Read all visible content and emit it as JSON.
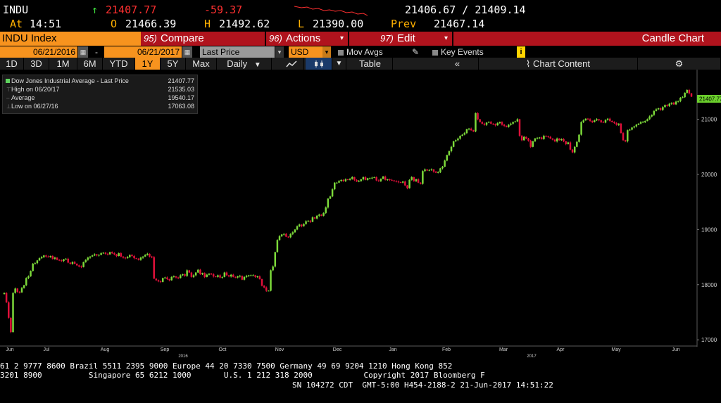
{
  "quote": {
    "ticker": "INDU",
    "up_arrow": "↑",
    "last": "21407.77",
    "change": "-59.37",
    "bid_ask": "21406.67 / 21409.14",
    "at_label": "At",
    "time": "14:51",
    "open_label": "O",
    "open": "21466.39",
    "high_label": "H",
    "high": "21492.62",
    "low_label": "L",
    "low": "21390.00",
    "prev_label": "Prev",
    "prev": "21467.14"
  },
  "titlebar": {
    "index": "INDU Index",
    "compare_num": "95)",
    "compare": "Compare",
    "actions_num": "96)",
    "actions": "Actions",
    "edit_num": "97)",
    "edit": "Edit",
    "dropdown_arrow": "▾",
    "chart_type": "Candle Chart"
  },
  "controls": {
    "start_date": "06/21/2016",
    "dash": "-",
    "end_date": "06/21/2017",
    "field": "Last Price",
    "currency": "USD",
    "mov_avgs": "Mov Avgs",
    "key_events": "Key Events",
    "info": "i",
    "calendar_icon": "calendar-icon",
    "pencil_icon": "pencil-icon"
  },
  "toolbar": {
    "periods": [
      "1D",
      "3D",
      "1M",
      "6M",
      "YTD",
      "1Y",
      "5Y",
      "Max"
    ],
    "active_period": "1Y",
    "frequency": "Daily",
    "freq_arrow": "▼",
    "table": "Table",
    "collapse": "«",
    "chart_content": "Chart Content",
    "settings": "⚙"
  },
  "legend": {
    "series": "Dow Jones Industrial Average - Last Price",
    "series_value": "21407.77",
    "high_label": "High on 06/20/17",
    "high_value": "21535.03",
    "avg_label": "Average",
    "avg_value": "19540.17",
    "low_label": "Low on 06/27/16",
    "low_value": "17063.08"
  },
  "chart_data": {
    "type": "candlestick",
    "title": "",
    "xlabel": "",
    "ylabel": "",
    "ylim": [
      16900,
      21900
    ],
    "yticks": [
      17000,
      18000,
      19000,
      20000,
      21000
    ],
    "last_price_label": "21407.77",
    "x_ticks": [
      "Jun",
      "Jul",
      "Aug",
      "Sep",
      "Oct",
      "Nov",
      "Dec",
      "Jan",
      "Feb",
      "Mar",
      "Apr",
      "May",
      "Jun"
    ],
    "year_labels": [
      "2016",
      "2017"
    ],
    "up_color": "#7cd93a",
    "down_color": "#e0103a",
    "grid": false,
    "closes": [
      17850,
      17680,
      17400,
      17140,
      17850,
      17930,
      17870,
      17860,
      17940,
      17990,
      18120,
      18150,
      18250,
      18380,
      18390,
      18440,
      18480,
      18500,
      18530,
      18510,
      18500,
      18520,
      18470,
      18490,
      18450,
      18440,
      18430,
      18460,
      18470,
      18400,
      18380,
      18410,
      18380,
      18350,
      18330,
      18320,
      18410,
      18450,
      18490,
      18510,
      18530,
      18550,
      18530,
      18540,
      18570,
      18580,
      18560,
      18550,
      18590,
      18570,
      18550,
      18520,
      18570,
      18510,
      18490,
      18480,
      18500,
      18540,
      18520,
      18480,
      18470,
      18450,
      18490,
      18510,
      18540,
      18560,
      18510,
      18500,
      18110,
      18080,
      18060,
      18050,
      18120,
      18130,
      18100,
      18080,
      18140,
      18150,
      18130,
      18120,
      18170,
      18190,
      18160,
      18260,
      18220,
      18140,
      18170,
      18220,
      18270,
      18190,
      18210,
      18140,
      18180,
      18200,
      18190,
      18150,
      18140,
      18170,
      18130,
      18140,
      18220,
      18170,
      18150,
      18180,
      18140,
      18130,
      18150,
      18160,
      18090,
      18140,
      18160,
      18170,
      18170,
      18170,
      18140,
      18150,
      18100,
      17980,
      17950,
      17890,
      17890,
      18260,
      18330,
      18590,
      18810,
      18880,
      18910,
      18920,
      18870,
      18860,
      18920,
      18950,
      19000,
      19060,
      19090,
      19060,
      19100,
      19150,
      19160,
      19140,
      19220,
      19200,
      19250,
      19270,
      19250,
      19300,
      19400,
      19560,
      19600,
      19730,
      19850,
      19850,
      19880,
      19900,
      19880,
      19910,
      19900,
      19920,
      19950,
      19900,
      19870,
      19880,
      19910,
      19950,
      19900,
      19930,
      19930,
      19940,
      19950,
      19890,
      19880,
      19920,
      19960,
      19900,
      19910,
      19900,
      19890,
      19880,
      19870,
      19860,
      19850,
      19870,
      19800,
      19750,
      19900,
      19950,
      19880,
      19910,
      19850,
      19830,
      20060,
      20090,
      20070,
      20080,
      20090,
      20050,
      20030,
      20040,
      20110,
      20140,
      20250,
      20350,
      20420,
      20500,
      20600,
      20620,
      20650,
      20700,
      20720,
      20750,
      20820,
      20830,
      20800,
      20780,
      21110,
      21000,
      20950,
      20920,
      20900,
      20940,
      20950,
      20920,
      20910,
      20890,
      20930,
      20950,
      20900,
      20880,
      20860,
      20900,
      20920,
      20950,
      20960,
      21000,
      20700,
      20620,
      20680,
      20650,
      20610,
      20500,
      20600,
      20650,
      20660,
      20670,
      20640,
      20700,
      20690,
      20680,
      20650,
      20630,
      20600,
      20650,
      20620,
      20640,
      20600,
      20550,
      20580,
      20450,
      20400,
      20500,
      20590,
      20720,
      20950,
      20980,
      21010,
      21000,
      20970,
      20950,
      20980,
      21000,
      20980,
      20950,
      20940,
      20990,
      21010,
      20970,
      20950,
      20930,
      20900,
      20920,
      20750,
      20620,
      20600,
      20800,
      20810,
      20850,
      20870,
      20900,
      20920,
      20950,
      20950,
      20970,
      21000,
      21050,
      21080,
      21150,
      21180,
      21200,
      21170,
      21220,
      21260,
      21240,
      21280,
      21300,
      21270,
      21320,
      21330,
      21390,
      21400,
      21480,
      21530,
      21470,
      21410
    ]
  },
  "footer": {
    "line1": "61 2 9777 8600 Brazil 5511 2395 9000 Europe 44 20 7330 7500 Germany 49 69 9204 1210 Hong Kong 852",
    "line2": "3201 8900          Singapore 65 6212 1000       U.S. 1 212 318 2000           Copyright 2017 Bloomberg F",
    "line3": "SN 104272 CDT  GMT-5:00 H454-2188-2 21-Jun-2017 14:51:22"
  }
}
